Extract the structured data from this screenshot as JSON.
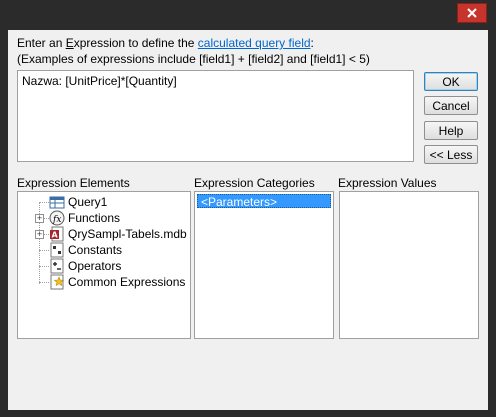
{
  "dialog": {
    "prompt_prefix": "Enter an ",
    "prompt_underlined": "E",
    "prompt_middle": "xpression to define the ",
    "prompt_link": "calculated query field",
    "prompt_suffix": ":",
    "example": "(Examples of expressions include [field1] + [field2] and [field1] < 5)",
    "expression_value": "Nazwa: [UnitPrice]*[Quantity]"
  },
  "buttons": {
    "ok": "OK",
    "cancel": "Cancel",
    "help": "Help",
    "less": "<< Less"
  },
  "panes": {
    "elements_label": "Expression Elements",
    "categories_label": "Expression Categories",
    "values_label": "Expression Values"
  },
  "elements": [
    {
      "label": "Query1",
      "icon": "query-icon",
      "expandable": false
    },
    {
      "label": "Functions",
      "icon": "function-icon",
      "expandable": true
    },
    {
      "label": "QrySampl-Tabels.mdb",
      "icon": "access-database-icon",
      "expandable": true
    },
    {
      "label": "Constants",
      "icon": "constants-icon",
      "expandable": false
    },
    {
      "label": "Operators",
      "icon": "operators-icon",
      "expandable": false
    },
    {
      "label": "Common Expressions",
      "icon": "common-expressions-icon",
      "expandable": false
    }
  ],
  "categories": [
    {
      "label": "<Parameters>",
      "selected": true
    }
  ],
  "values": [],
  "colors": {
    "close_button": "#c7342b",
    "link": "#0066cc",
    "selection": "#3399ff"
  }
}
